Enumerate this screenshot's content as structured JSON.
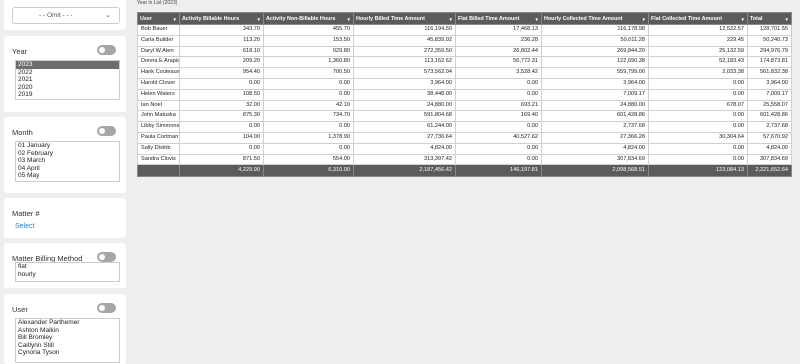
{
  "omit_select": {
    "value": "- - Omit - - -",
    "chevron": "chevron-down-icon"
  },
  "filters": {
    "year": {
      "title": "Year",
      "options": [
        "2023",
        "2022",
        "2021",
        "2020",
        "2019"
      ],
      "selected": "2023"
    },
    "month": {
      "title": "Month",
      "options": [
        "01 January",
        "02 February",
        "03 March",
        "04 April",
        "05 May"
      ]
    },
    "matter": {
      "title": "Matter #",
      "link": "Select"
    },
    "billing_method": {
      "title": "Matter Billing Method",
      "options": [
        "flat",
        "hourly"
      ]
    },
    "user": {
      "title": "User",
      "options": [
        "Alexander Parthemer",
        "Ashton Malkin",
        "Bill Bromley",
        "Caitlynn Still",
        "Cynoria Tyson"
      ]
    }
  },
  "report": {
    "caption": "Year in List (2023)",
    "columns": [
      "User",
      "Activity Billable Hours",
      "Activity Non-Billable Hours",
      "Hourly Billed Time Amount",
      "Flat Billed Time Amount",
      "Hourly Collected Time Amount",
      "Flat Collected Time Amount",
      "Total"
    ],
    "rows": [
      [
        "Bob Bauer",
        "343.70",
        "455.70",
        "116,194.50",
        "17,468.13",
        "116,178.98",
        "12,522.57",
        "128,701.55"
      ],
      [
        "Carla Builder",
        "113.20",
        "153.50",
        "45,839.02",
        "236.28",
        "50,011.28",
        "229.45",
        "50,240.73"
      ],
      [
        "Daryl W Aten",
        "618.10",
        "929.80",
        "272,359.50",
        "26,802.44",
        "269,844.20",
        "25,132.59",
        "294,976.79"
      ],
      [
        "Donna E Arapia",
        "209.20",
        "1,360.80",
        "113,162.62",
        "56,772.31",
        "122,690.38",
        "52,183.43",
        "174,873.81"
      ],
      [
        "Hank Couteaux",
        "954.40",
        "700.50",
        "573,562.04",
        "3,528.42",
        "559,799.00",
        "2,033.38",
        "561,832.38"
      ],
      [
        "Harold Clover",
        "0.00",
        "0.00",
        "3,964.00",
        "0.00",
        "3,964.00",
        "0.00",
        "3,964.00"
      ],
      [
        "Helen Waters",
        "108.50",
        "0.00",
        "38,448.00",
        "0.00",
        "7,009.17",
        "0.00",
        "7,009.17"
      ],
      [
        "Ian Noel",
        "32.00",
        "42.10",
        "24,880.00",
        "693.21",
        "24,880.00",
        "678.07",
        "25,558.07"
      ],
      [
        "John Matuska",
        "875.30",
        "734.70",
        "591,804.68",
        "169.40",
        "601,428.86",
        "0.00",
        "601,428.86"
      ],
      [
        "Libby Simmons",
        "0.00",
        "0.00",
        "61,244.00",
        "0.00",
        "2,737.68",
        "0.00",
        "2,737.68"
      ],
      [
        "Paula Cortman",
        "104.00",
        "1,378.90",
        "27,736.64",
        "40,527.62",
        "27,366.28",
        "30,304.64",
        "57,670.92"
      ],
      [
        "Sally Distrib",
        "0.00",
        "0.00",
        "4,824.00",
        "0.00",
        "4,824.00",
        "0.00",
        "4,824.00"
      ],
      [
        "Sandra Clovis",
        "871.50",
        "554.00",
        "313,397.42",
        "0.00",
        "307,834.69",
        "0.00",
        "307,834.69"
      ]
    ],
    "totals": [
      "",
      "4,229.90",
      "6,310.00",
      "2,187,456.42",
      "146,197.81",
      "2,098,568.51",
      "123,084.13",
      "2,221,652.64"
    ]
  }
}
